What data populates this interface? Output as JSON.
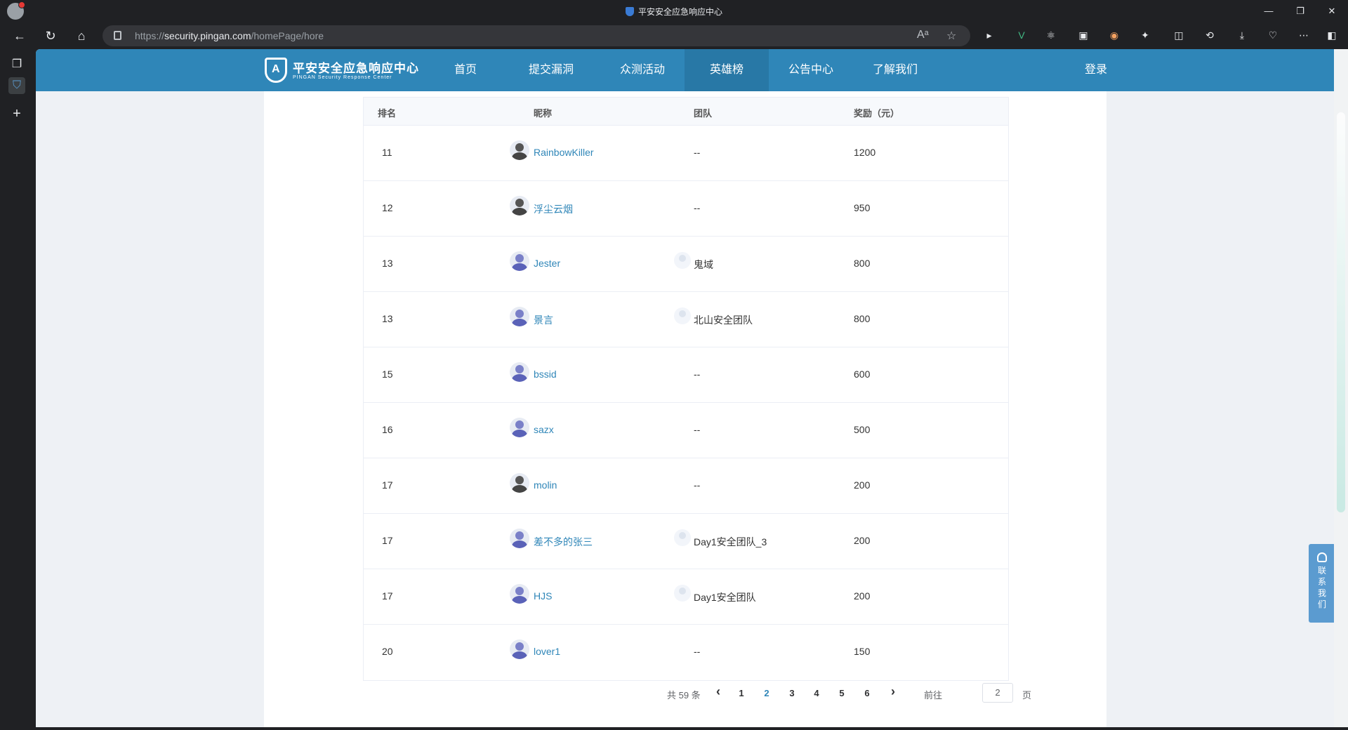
{
  "browser": {
    "tab_title": "平安安全应急响应中心",
    "url_prefix": "https://",
    "url_host": "security.pingan.com",
    "url_path": "/homePage/hore"
  },
  "site": {
    "logo_name": "平安安全应急响应中心",
    "logo_sub": "PINGAN Security Response Center",
    "nav": [
      "首页",
      "提交漏洞",
      "众测活动",
      "英雄榜",
      "公告中心",
      "了解我们"
    ],
    "active_nav": "英雄榜",
    "login": "登录"
  },
  "table": {
    "headers": {
      "rank": "排名",
      "nick": "昵称",
      "team": "团队",
      "reward": "奖励（元）"
    },
    "rows": [
      {
        "rank": "11",
        "nick": "RainbowKiller",
        "team": "--",
        "reward": "1200",
        "has_team_avatar": false
      },
      {
        "rank": "12",
        "nick": "浮尘云烟",
        "team": "--",
        "reward": "950",
        "has_team_avatar": false
      },
      {
        "rank": "13",
        "nick": "Jester",
        "team": "鬼域",
        "reward": "800",
        "has_team_avatar": true
      },
      {
        "rank": "13",
        "nick": "景言",
        "team": "北山安全团队",
        "reward": "800",
        "has_team_avatar": true
      },
      {
        "rank": "15",
        "nick": "bssid",
        "team": "--",
        "reward": "600",
        "has_team_avatar": false
      },
      {
        "rank": "16",
        "nick": "sazx",
        "team": "--",
        "reward": "500",
        "has_team_avatar": false
      },
      {
        "rank": "17",
        "nick": "molin",
        "team": "--",
        "reward": "200",
        "has_team_avatar": false
      },
      {
        "rank": "17",
        "nick": "差不多的张三",
        "team": "Day1安全团队_3",
        "reward": "200",
        "has_team_avatar": true
      },
      {
        "rank": "17",
        "nick": "HJS",
        "team": "Day1安全团队",
        "reward": "200",
        "has_team_avatar": true
      },
      {
        "rank": "20",
        "nick": "lover1",
        "team": "--",
        "reward": "150",
        "has_team_avatar": false
      }
    ]
  },
  "pagination": {
    "total": "共 59 条",
    "prev": "‹",
    "pages": [
      "1",
      "2",
      "3",
      "4",
      "5",
      "6"
    ],
    "current": "2",
    "next": "›",
    "goto_label": "前往",
    "goto_value": "2",
    "goto_suffix": "页"
  },
  "contact": {
    "label": "联系我们"
  }
}
